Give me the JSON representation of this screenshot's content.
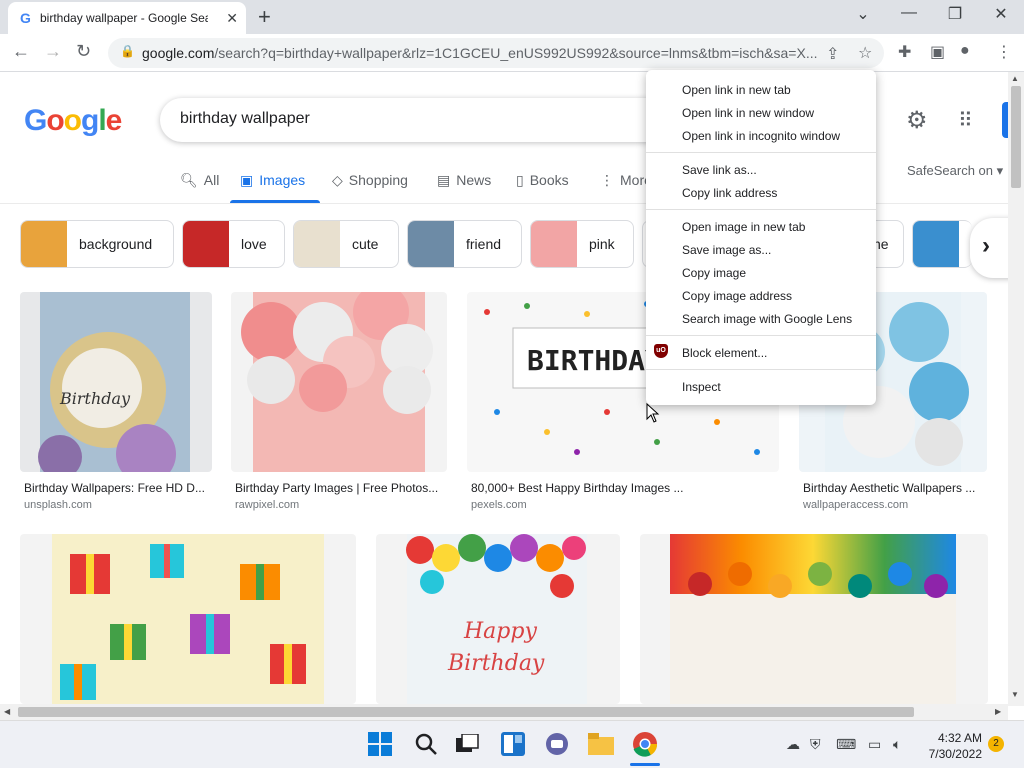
{
  "browser": {
    "tab_title": "birthday wallpaper - Google Sea",
    "tab_favicon": "G",
    "url_host": "google.com",
    "url_rest": "/search?q=birthday+wallpaper&rlz=1C1GCEU_enUS992US992&source=lnms&tbm=isch&sa=X..."
  },
  "google": {
    "logo": [
      "G",
      "o",
      "o",
      "g",
      "l",
      "e"
    ],
    "logo_colors": [
      "#4285f4",
      "#ea4335",
      "#fbbc05",
      "#4285f4",
      "#34a853",
      "#ea4335"
    ],
    "query": "birthday wallpaper",
    "tabs": [
      {
        "label": "All",
        "icon": "search-icon"
      },
      {
        "label": "Images",
        "icon": "image-icon"
      },
      {
        "label": "Shopping",
        "icon": "tag-icon"
      },
      {
        "label": "News",
        "icon": "news-icon"
      },
      {
        "label": "Books",
        "icon": "book-icon"
      },
      {
        "label": "More",
        "icon": "more-vert-icon"
      }
    ],
    "safesearch": "SafeSearch on"
  },
  "chips": [
    {
      "label": "background",
      "color": "#e8a33c"
    },
    {
      "label": "love",
      "color": "#c62828"
    },
    {
      "label": "cute",
      "color": "#e8e0cf"
    },
    {
      "label": "friend",
      "color": "#6d8ba6"
    },
    {
      "label": "pink",
      "color": "#f2a5a5"
    },
    {
      "label": "ne",
      "color": "#c9d4e0"
    }
  ],
  "results": [
    {
      "caption": "Birthday Wallpapers: Free HD D...",
      "source": "unsplash.com",
      "color": "#9fb2c5"
    },
    {
      "caption": "Birthday Party Images | Free Photos...",
      "source": "rawpixel.com",
      "color": "#f2b6b6"
    },
    {
      "caption": "80,000+ Best Happy Birthday Images ...",
      "source": "pexels.com",
      "color": "#f6f6f6"
    },
    {
      "caption": "Birthday Aesthetic Wallpapers ...",
      "source": "wallpaperaccess.com",
      "color": "#a8d4e8"
    },
    {
      "caption": "",
      "source": "",
      "color": "#f7f0c9"
    },
    {
      "caption": "",
      "source": "",
      "color": "#e9f0f4"
    },
    {
      "caption": "",
      "source": "",
      "color": "#f2ead2"
    }
  ],
  "image_texts": {
    "birthday_sign": "BIRTHDAY",
    "happy": "Happy",
    "birthday_script": "Birthday",
    "balloon_script": "Birthday"
  },
  "context_menu": {
    "group1": [
      "Open link in new tab",
      "Open link in new window",
      "Open link in incognito window"
    ],
    "group2": [
      "Save link as...",
      "Copy link address"
    ],
    "group3": [
      "Open image in new tab",
      "Save image as...",
      "Copy image",
      "Copy image address",
      "Search image with Google Lens"
    ],
    "group4": [
      "Block element..."
    ],
    "group5": [
      "Inspect"
    ],
    "ubo_label": "uO"
  },
  "taskbar": {
    "time": "4:32 AM",
    "date": "7/30/2022",
    "notifications": "2"
  }
}
